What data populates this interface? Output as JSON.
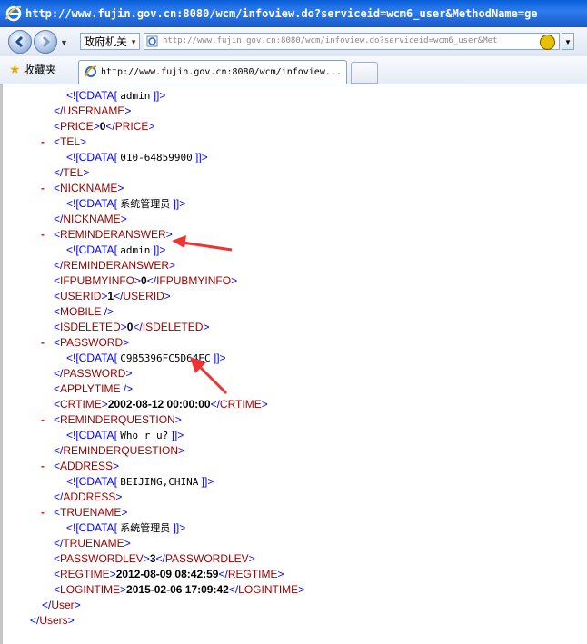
{
  "window": {
    "title": "http://www.fujin.gov.cn:8080/wcm/infoview.do?serviceid=wcm6_user&MethodName=ge"
  },
  "toolbar": {
    "category_combo": "政府机关",
    "address_url": "http://www.fujin.gov.cn:8080/wcm/infoview.do?serviceid=wcm6_user&Met"
  },
  "favorites": {
    "label": "收藏夹",
    "tab_title": "http://www.fujin.gov.cn:8080/wcm/infoview..."
  },
  "xml": {
    "cdata_open": "<![CDATA[",
    "cdata_close": "]]>",
    "collapse_marker": "-",
    "lines": [
      {
        "kind": "cdata",
        "value": "admin"
      },
      {
        "kind": "close",
        "tag": "USERNAME"
      },
      {
        "kind": "value",
        "tag": "PRICE",
        "value": "0"
      },
      {
        "kind": "open",
        "tag": "TEL"
      },
      {
        "kind": "cdata",
        "value": "010-64859900"
      },
      {
        "kind": "close",
        "tag": "TEL"
      },
      {
        "kind": "open",
        "tag": "NICKNAME"
      },
      {
        "kind": "cdata",
        "value": "系统管理员"
      },
      {
        "kind": "close",
        "tag": "NICKNAME"
      },
      {
        "kind": "open",
        "tag": "REMINDERANSWER"
      },
      {
        "kind": "cdata",
        "value": "admin"
      },
      {
        "kind": "close",
        "tag": "REMINDERANSWER"
      },
      {
        "kind": "value",
        "tag": "IFPUBMYINFO",
        "value": "0"
      },
      {
        "kind": "value",
        "tag": "USERID",
        "value": "1"
      },
      {
        "kind": "empty",
        "tag": "MOBILE"
      },
      {
        "kind": "value",
        "tag": "ISDELETED",
        "value": "0"
      },
      {
        "kind": "open",
        "tag": "PASSWORD"
      },
      {
        "kind": "cdata",
        "value": "C9B5396FC5D64EC"
      },
      {
        "kind": "close",
        "tag": "PASSWORD"
      },
      {
        "kind": "empty",
        "tag": "APPLYTIME"
      },
      {
        "kind": "value",
        "tag": "CRTIME",
        "value": "2002-08-12 00:00:00"
      },
      {
        "kind": "open",
        "tag": "REMINDERQUESTION"
      },
      {
        "kind": "cdata",
        "value": "Who r u?"
      },
      {
        "kind": "close",
        "tag": "REMINDERQUESTION"
      },
      {
        "kind": "open",
        "tag": "ADDRESS"
      },
      {
        "kind": "cdata",
        "value": "BEIJING,CHINA"
      },
      {
        "kind": "close",
        "tag": "ADDRESS"
      },
      {
        "kind": "open",
        "tag": "TRUENAME"
      },
      {
        "kind": "cdata",
        "value": "系统管理员"
      },
      {
        "kind": "close",
        "tag": "TRUENAME"
      },
      {
        "kind": "value",
        "tag": "PASSWORDLEV",
        "value": "3"
      },
      {
        "kind": "value",
        "tag": "REGTIME",
        "value": "2012-08-09 08:42:59"
      },
      {
        "kind": "value",
        "tag": "LOGINTIME",
        "value": "2015-02-06 17:09:42"
      },
      {
        "kind": "close",
        "tag": "User"
      },
      {
        "kind": "close",
        "tag": "Users"
      }
    ]
  },
  "colors": {
    "markup": "#0000ff",
    "tag_name": "#990000",
    "collapse_marker": "#ff0000",
    "annotation_arrow": "#ee3333",
    "title_bar": "#1a62d6"
  }
}
